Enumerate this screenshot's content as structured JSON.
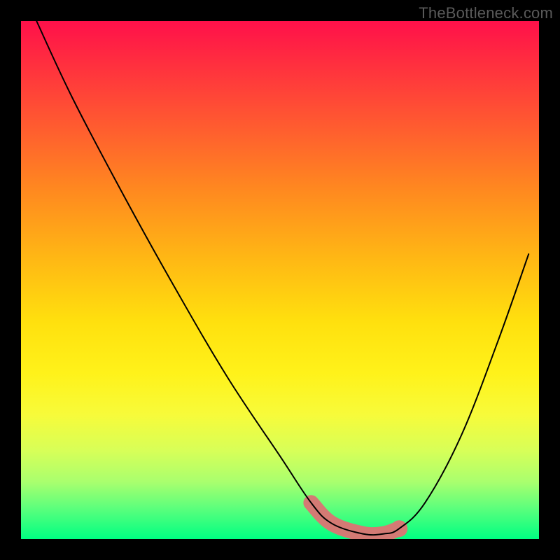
{
  "watermark": "TheBottleneck.com",
  "chart_data": {
    "type": "line",
    "title": "",
    "xlabel": "",
    "ylabel": "",
    "xlim": [
      0,
      100
    ],
    "ylim": [
      0,
      100
    ],
    "grid": false,
    "legend": false,
    "annotations": [],
    "background_gradient": {
      "orientation": "vertical",
      "stops": [
        {
          "pos": 0,
          "color": "#ff104a"
        },
        {
          "pos": 50,
          "color": "#ffd40e"
        },
        {
          "pos": 100,
          "color": "#00ff82"
        }
      ]
    },
    "series": [
      {
        "name": "curve",
        "x": [
          3,
          10,
          20,
          30,
          40,
          50,
          56,
          60,
          66,
          70,
          73,
          78,
          85,
          92,
          98
        ],
        "values": [
          100,
          85,
          66,
          48,
          31,
          16,
          7,
          3,
          1,
          1,
          2,
          7,
          20,
          38,
          55
        ]
      }
    ],
    "highlight": {
      "series": "curve",
      "x_range": [
        56,
        73
      ],
      "color": "#d47a74",
      "marker_at_x": 73
    }
  }
}
